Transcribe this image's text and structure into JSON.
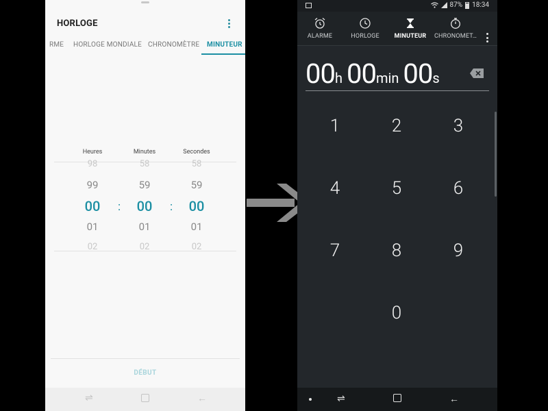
{
  "left": {
    "title": "HORLOGE",
    "tabs": [
      "RME",
      "HORLOGE MONDIALE",
      "CHRONOMÈTRE",
      "MINUTEUR"
    ],
    "active_tab": "MINUTEUR",
    "picker": {
      "headers": [
        "Heures",
        "Minutes",
        "Secondes"
      ],
      "hours": [
        "98",
        "99",
        "00",
        "01",
        "02"
      ],
      "minutes": [
        "58",
        "59",
        "00",
        "01",
        "02"
      ],
      "seconds": [
        "58",
        "59",
        "00",
        "01",
        "02"
      ],
      "separator": ":"
    },
    "start_button": "DÉBUT",
    "nav_icons": [
      "recent-apps-icon",
      "home-icon",
      "back-icon"
    ]
  },
  "right": {
    "status": {
      "battery": "87%",
      "time": "18:34",
      "icons": [
        "image-notification-icon",
        "wifi-icon",
        "signal-icon",
        "battery-icon"
      ]
    },
    "tabs": [
      {
        "label": "ALARME",
        "icon": "alarm-icon"
      },
      {
        "label": "HORLOGE",
        "icon": "clock-icon"
      },
      {
        "label": "MINUTEUR",
        "icon": "hourglass-icon"
      },
      {
        "label": "CHRONOMÈT…",
        "icon": "stopwatch-icon"
      }
    ],
    "active_tab": "MINUTEUR",
    "time_display": {
      "hours": "00",
      "hours_unit": "h",
      "minutes": "00",
      "minutes_unit": "min",
      "seconds": "00",
      "seconds_unit": "s"
    },
    "keypad": [
      "1",
      "2",
      "3",
      "4",
      "5",
      "6",
      "7",
      "8",
      "9",
      "0"
    ],
    "nav_icons": [
      "dot-icon",
      "recent-apps-icon",
      "home-icon",
      "back-icon"
    ]
  },
  "colors": {
    "accent_teal": "#1c8fa3",
    "light_bg": "#f8f8f8",
    "dark_bg": "#23272b",
    "arrow": "#8a8a8a"
  }
}
